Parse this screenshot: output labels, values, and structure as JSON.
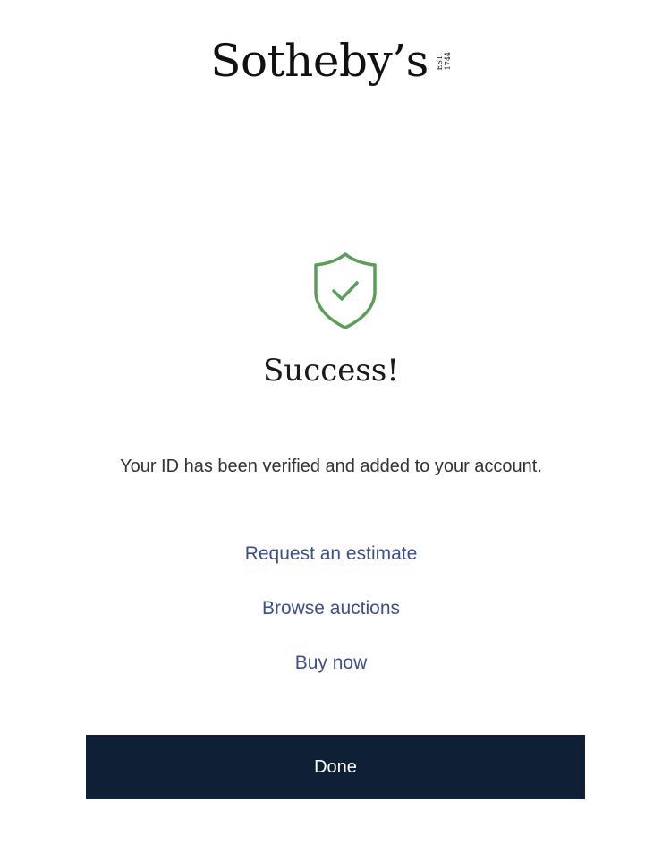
{
  "brand": {
    "name": "Sotheby’s",
    "est_line1": "EST.",
    "est_line2": "1744"
  },
  "status": {
    "icon": "shield-check-icon",
    "title": "Success!",
    "message": "Your ID has been verified and added to your account.",
    "icon_color": "#5a9e5a"
  },
  "links": [
    {
      "label": "Request an estimate"
    },
    {
      "label": "Browse auctions"
    },
    {
      "label": "Buy now"
    }
  ],
  "actions": {
    "done_label": "Done"
  },
  "colors": {
    "link": "#3d4f86",
    "button_bg": "#0f2036",
    "button_text": "#ffffff"
  }
}
